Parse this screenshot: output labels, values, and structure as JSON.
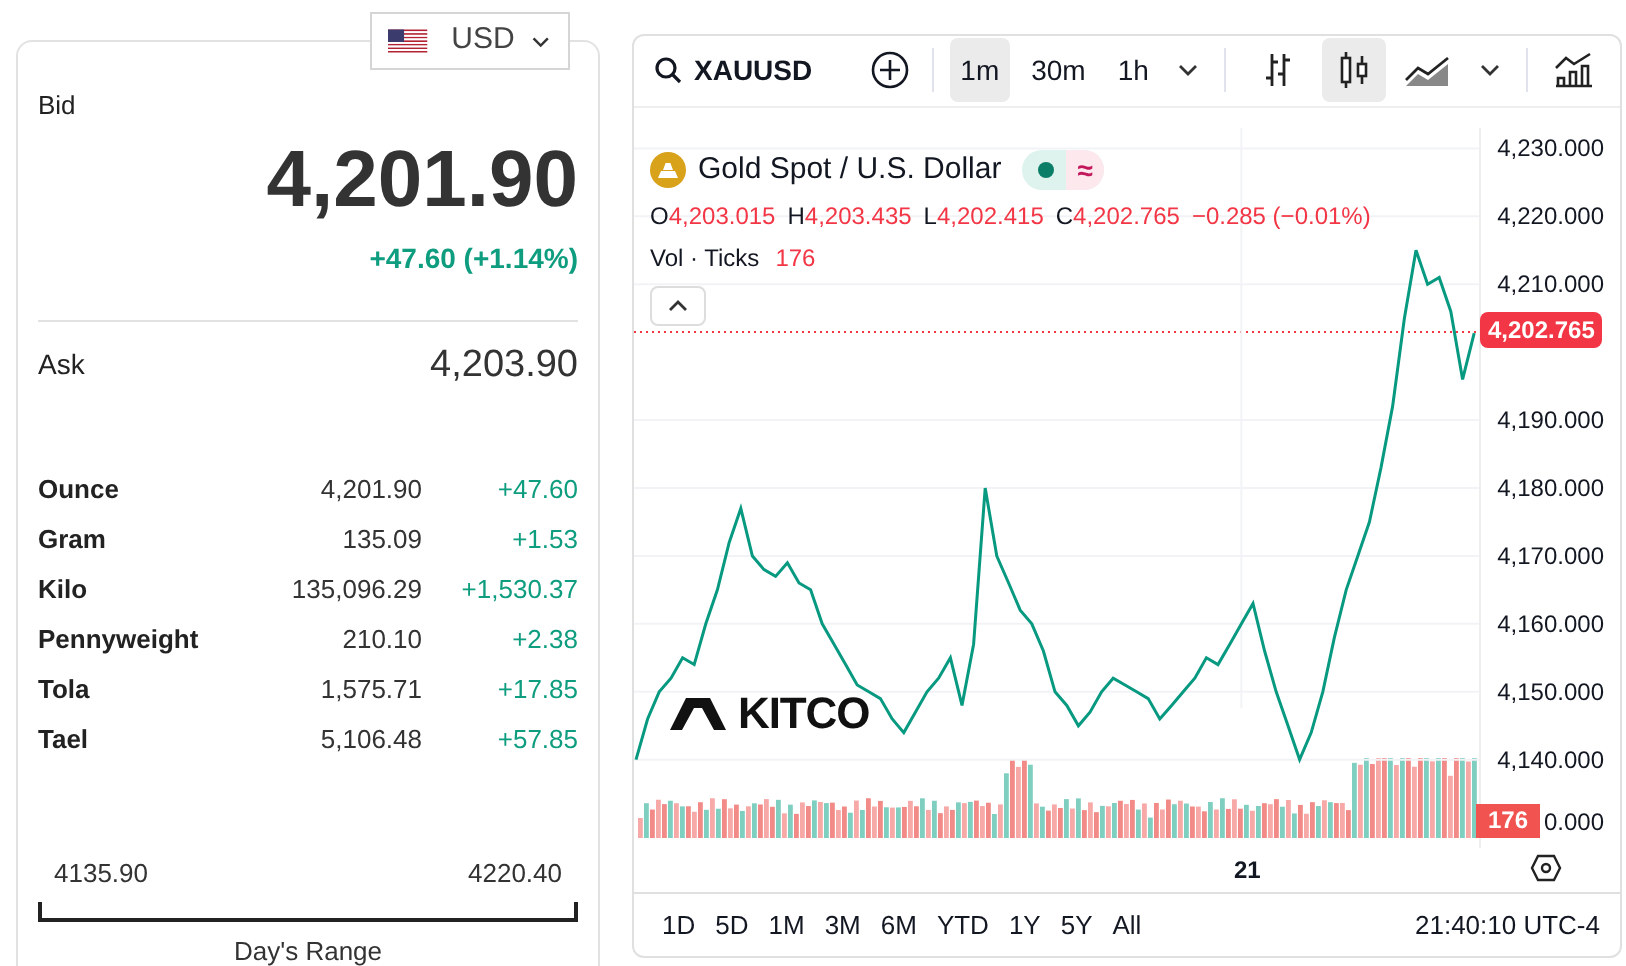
{
  "currency": {
    "label": "USD"
  },
  "quote": {
    "bid_label": "Bid",
    "bid": "4,201.90",
    "change": "+47.60 (+1.14%)",
    "ask_label": "Ask",
    "ask": "4,203.90"
  },
  "units": [
    {
      "name": "Ounce",
      "price": "4,201.90",
      "change": "+47.60"
    },
    {
      "name": "Gram",
      "price": "135.09",
      "change": "+1.53"
    },
    {
      "name": "Kilo",
      "price": "135,096.29",
      "change": "+1,530.37"
    },
    {
      "name": "Pennyweight",
      "price": "210.10",
      "change": "+2.38"
    },
    {
      "name": "Tola",
      "price": "1,575.71",
      "change": "+17.85"
    },
    {
      "name": "Tael",
      "price": "5,106.48",
      "change": "+57.85"
    }
  ],
  "day_range": {
    "low": "4135.90",
    "high": "4220.40",
    "label": "Day's Range"
  },
  "chart": {
    "symbol": "XAUUSD",
    "intervals": [
      {
        "label": "1m",
        "selected": true
      },
      {
        "label": "30m",
        "selected": false
      },
      {
        "label": "1h",
        "selected": false
      }
    ],
    "styles": [
      {
        "kind": "bars",
        "selected": false
      },
      {
        "kind": "candles",
        "selected": true
      },
      {
        "kind": "area",
        "selected": false
      }
    ],
    "title": "Gold Spot / U.S. Dollar",
    "status_symbol": "≈",
    "ohlc": [
      {
        "key": "O",
        "value": "4,203.015"
      },
      {
        "key": "H",
        "value": "4,203.435"
      },
      {
        "key": "L",
        "value": "4,202.415"
      },
      {
        "key": "C",
        "value": "4,202.765"
      }
    ],
    "ohlc_change": "−0.285 (−0.01%)",
    "volume_label": "Vol · Ticks",
    "volume_value": "176",
    "price_badge": "4,202.765",
    "volume_badge": "176",
    "logo": "KITCO",
    "chart_data": {
      "type": "line",
      "categories": [
        null,
        null,
        null,
        null,
        null,
        null,
        null,
        null,
        null,
        null,
        null,
        null,
        null,
        null,
        null,
        null,
        null,
        null,
        null,
        null,
        null,
        null,
        null,
        null,
        null,
        null,
        null,
        null,
        null,
        null,
        null,
        null,
        null,
        null,
        null,
        null,
        null,
        null,
        null,
        null,
        null,
        null,
        null,
        null,
        null,
        null,
        null,
        null,
        null,
        null,
        null,
        null,
        null,
        null,
        null,
        null,
        null,
        null,
        null,
        null,
        null,
        null,
        null,
        null,
        null,
        null,
        null,
        null,
        null,
        null,
        null,
        null,
        null
      ],
      "series": [
        {
          "color": "#089981",
          "values": [
            4140,
            4146,
            4150,
            4152,
            4155,
            4154,
            4160,
            4165,
            4172,
            4177,
            4170,
            4168,
            4167,
            4169,
            4166,
            4165,
            4160,
            4157,
            4154,
            4151,
            4150,
            4149,
            4146,
            4144,
            4147,
            4150,
            4152,
            4155,
            4148,
            4157,
            4180,
            4170,
            4166,
            4162,
            4160,
            4156,
            4150,
            4148,
            4145,
            4147,
            4150,
            4152,
            4151,
            4150,
            4149,
            4146,
            4148,
            4150,
            4152,
            4155,
            4154,
            4157,
            4160,
            4163,
            4156,
            4150,
            4145,
            4140,
            4144,
            4150,
            4158,
            4165,
            4170,
            4175,
            4183,
            4192,
            4205,
            4215,
            4210,
            4211,
            4206,
            4196,
            4202.8
          ]
        }
      ],
      "grid": true,
      "ylim": [
        4127,
        4233
      ],
      "yticks": [
        {
          "value": 4140,
          "label": "4,140.000"
        },
        {
          "value": 4150,
          "label": "4,150.000"
        },
        {
          "value": 4160,
          "label": "4,160.000"
        },
        {
          "value": 4170,
          "label": "4,170.000"
        },
        {
          "value": 4180,
          "label": "4,180.000"
        },
        {
          "value": 4190,
          "label": "4,190.000"
        },
        {
          "value": 4210,
          "label": "4,210.000"
        },
        {
          "value": 4220,
          "label": "4,220.000"
        },
        {
          "value": 4230,
          "label": "4,230.000"
        }
      ]
    },
    "cut_axis_label": "0.000",
    "x_axis_label": "21",
    "ranges": [
      {
        "label": "1D"
      },
      {
        "label": "5D"
      },
      {
        "label": "1M"
      },
      {
        "label": "3M"
      },
      {
        "label": "6M"
      },
      {
        "label": "YTD"
      },
      {
        "label": "1Y"
      },
      {
        "label": "5Y"
      },
      {
        "label": "All"
      }
    ],
    "time": "21:40:10 UTC-4"
  }
}
